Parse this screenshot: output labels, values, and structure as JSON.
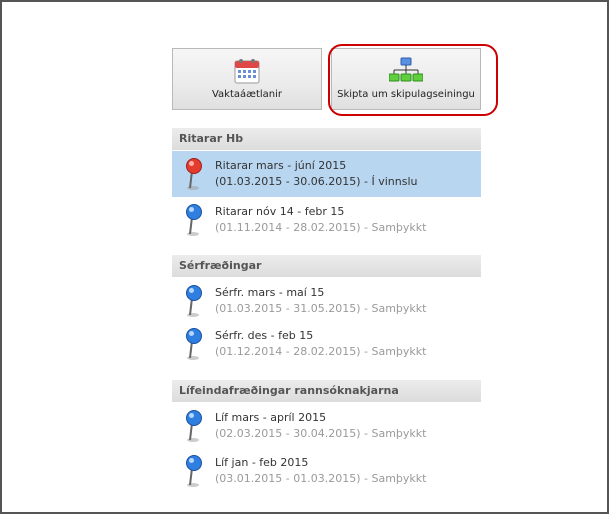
{
  "toolbar": {
    "schedules_label": "Vaktaáætlanir",
    "switch_unit_label": "Skipta um skipulagseiningu"
  },
  "sections": [
    {
      "title": "Ritarar Hb",
      "items": [
        {
          "title": "Ritarar mars - júní 2015",
          "sub": "(01.03.2015 - 30.06.2015) - Í vinnslu",
          "pin": "red"
        },
        {
          "title": "Ritarar nóv 14 - febr 15",
          "sub": "(01.11.2014 - 28.02.2015) - Samþykkt",
          "pin": "blue"
        }
      ]
    },
    {
      "title": "Sérfræðingar",
      "items": [
        {
          "title": "Sérfr. mars - maí 15",
          "sub": "(01.03.2015 - 31.05.2015) - Samþykkt",
          "pin": "blue"
        },
        {
          "title": "Sérfr. des - feb 15",
          "sub": "(01.12.2014 - 28.02.2015) - Samþykkt",
          "pin": "blue"
        }
      ]
    },
    {
      "title": "Lífeindafræðingar rannsóknakjarna",
      "items": [
        {
          "title": "Líf mars - apríl 2015",
          "sub": "(02.03.2015 - 30.04.2015) - Samþykkt",
          "pin": "blue"
        },
        {
          "title": "Líf jan - feb 2015",
          "sub": "(03.01.2015 - 01.03.2015) - Samþykkt",
          "pin": "blue"
        }
      ]
    }
  ],
  "colors": {
    "selected_row": "#b8d6ef",
    "highlight_ring": "#cc0000",
    "pin_red": "#e33b2e",
    "pin_blue": "#2f7fe0"
  }
}
